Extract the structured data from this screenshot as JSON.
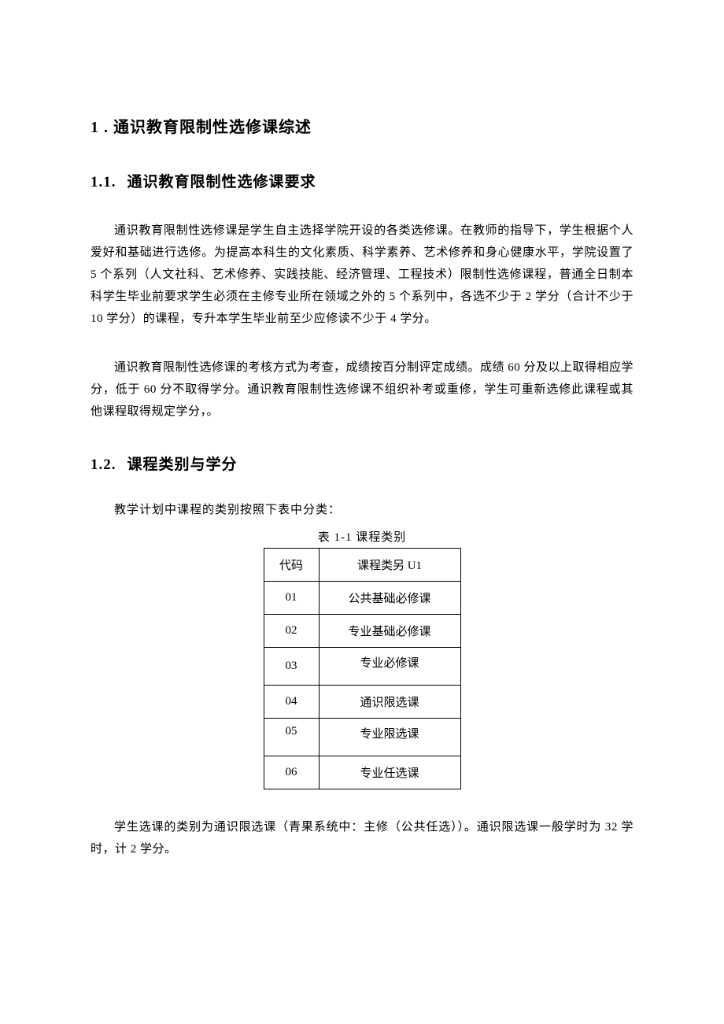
{
  "heading1": {
    "num": "1 .",
    "text": "通识教育限制性选修课综述"
  },
  "heading11": {
    "num": "1.1.",
    "text": "通识教育限制性选修课要求"
  },
  "para1": "通识教育限制性选修课是学生自主选择学院开设的各类选修课。在教师的指导下，学生根据个人爱好和基础进行选修。为提高本科生的文化素质、科学素养、艺术修养和身心健康水平，学院设置了 5 个系列（人文社科、艺术修养、实践技能、经济管理、工程技术）限制性选修课程，普通全日制本科学生毕业前要求学生必须在主修专业所在领域之外的 5 个系列中，各选不少于 2 学分（合计不少于 10 学分）的课程，专升本学生毕业前至少应修读不少于 4 学分。",
  "para2": "通识教育限制性选修课的考核方式为考查，成绩按百分制评定成绩。成绩 60 分及以上取得相应学分，低于 60 分不取得学分。通识教育限制性选修课不组织补考或重修，学生可重新选修此课程或其他课程取得规定学分，。",
  "heading12": {
    "num": "1.2.",
    "text": "课程类别与学分"
  },
  "introLine": "教学计划中课程的类别按照下表中分类：",
  "tableCaption": "表 1-1 课程类别",
  "table": {
    "header": {
      "code": "代码",
      "name": "课程类另 U1"
    },
    "rows": [
      {
        "code": "01",
        "name": "公共基础必修课"
      },
      {
        "code": "02",
        "name": "专业基础必修课"
      },
      {
        "code": "03",
        "name": "专业必修课"
      },
      {
        "code": "04",
        "name": "通识限选课"
      },
      {
        "code": "05",
        "name": "专业限选课"
      },
      {
        "code": "06",
        "name": "专业任选课"
      }
    ]
  },
  "para3": "学生选课的类别为通识限选课（青果系统中：主修（公共任选））。通识限选课一般学时为 32 学时，计 2 学分。"
}
